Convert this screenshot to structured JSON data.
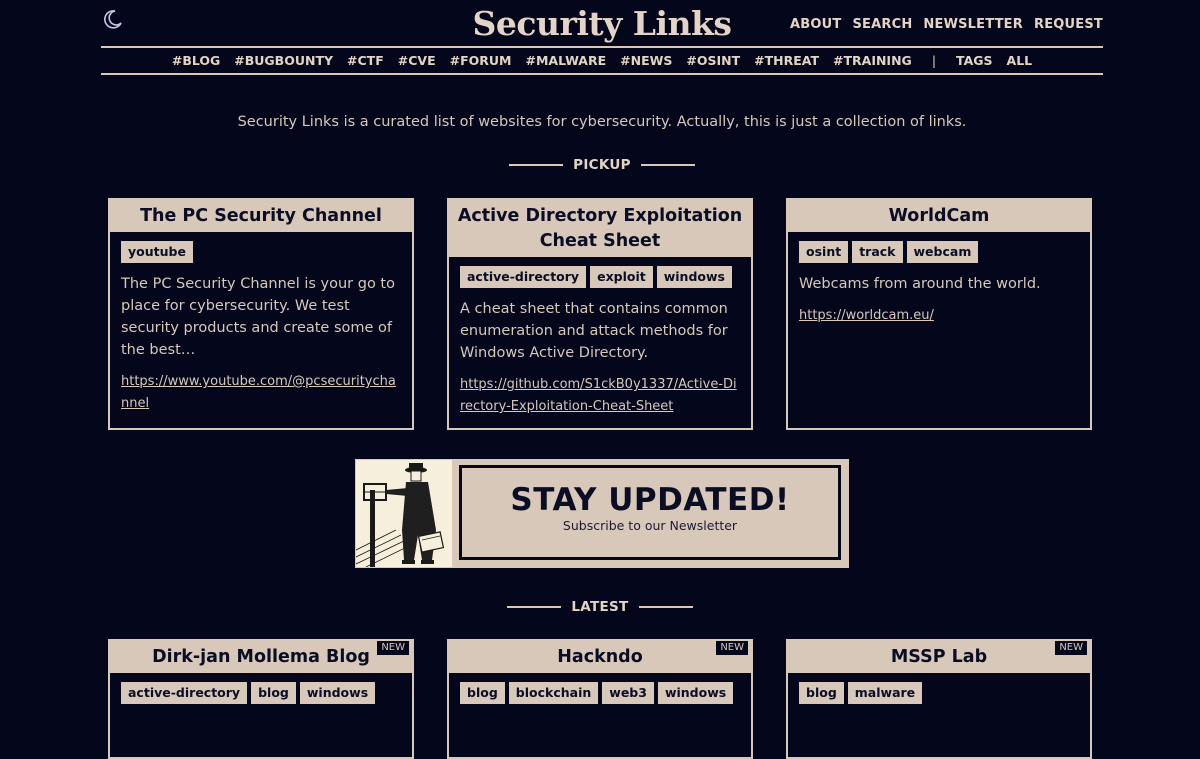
{
  "header": {
    "title": "Security Links",
    "nav": [
      "ABOUT",
      "SEARCH",
      "NEWSLETTER",
      "REQUEST"
    ]
  },
  "categories": [
    "#BLOG",
    "#BUGBOUNTY",
    "#CTF",
    "#CVE",
    "#FORUM",
    "#MALWARE",
    "#NEWS",
    "#OSINT",
    "#THREAT",
    "#TRAINING"
  ],
  "category_separator": "|",
  "extra_nav": [
    "TAGS",
    "ALL"
  ],
  "intro": "Security Links is a curated list of websites for cybersecurity. Actually, this is just a collection of links.",
  "pickup": {
    "heading": "PICKUP",
    "cards": [
      {
        "title": "The PC Security Channel",
        "tags": [
          "youtube"
        ],
        "description": "The PC Security Channel is your go to place for cybersecurity. We test security products and create some of the best…",
        "url": "https://www.youtube.com/@pcsecuritychannel"
      },
      {
        "title": "Active Directory Exploitation Cheat Sheet",
        "tags": [
          "active-directory",
          "exploit",
          "windows"
        ],
        "description": "A cheat sheet that contains common enumeration and attack methods for Windows Active Directory.",
        "url": "https://github.com/S1ckB0y1337/Active-Directory-Exploitation-Cheat-Sheet"
      },
      {
        "title": "WorldCam",
        "tags": [
          "osint",
          "track",
          "webcam"
        ],
        "description": "Webcams from around the world.",
        "url": "https://worldcam.eu/"
      }
    ]
  },
  "banner": {
    "heading": "STAY UPDATED!",
    "subheading": "Subscribe to our Newsletter"
  },
  "latest": {
    "heading": "LATEST",
    "badge": "NEW",
    "cards": [
      {
        "title": "Dirk-jan Mollema Blog",
        "tags": [
          "active-directory",
          "blog",
          "windows"
        ]
      },
      {
        "title": "Hackndo",
        "tags": [
          "blog",
          "blockchain",
          "web3",
          "windows"
        ]
      },
      {
        "title": "MSSP Lab",
        "tags": [
          "blog",
          "malware"
        ]
      }
    ]
  },
  "colors": {
    "background": "#04061c",
    "accent": "#d7c8ba",
    "dark_text": "#0b0d24"
  },
  "icons": {
    "theme_toggle": "moon-icon"
  }
}
